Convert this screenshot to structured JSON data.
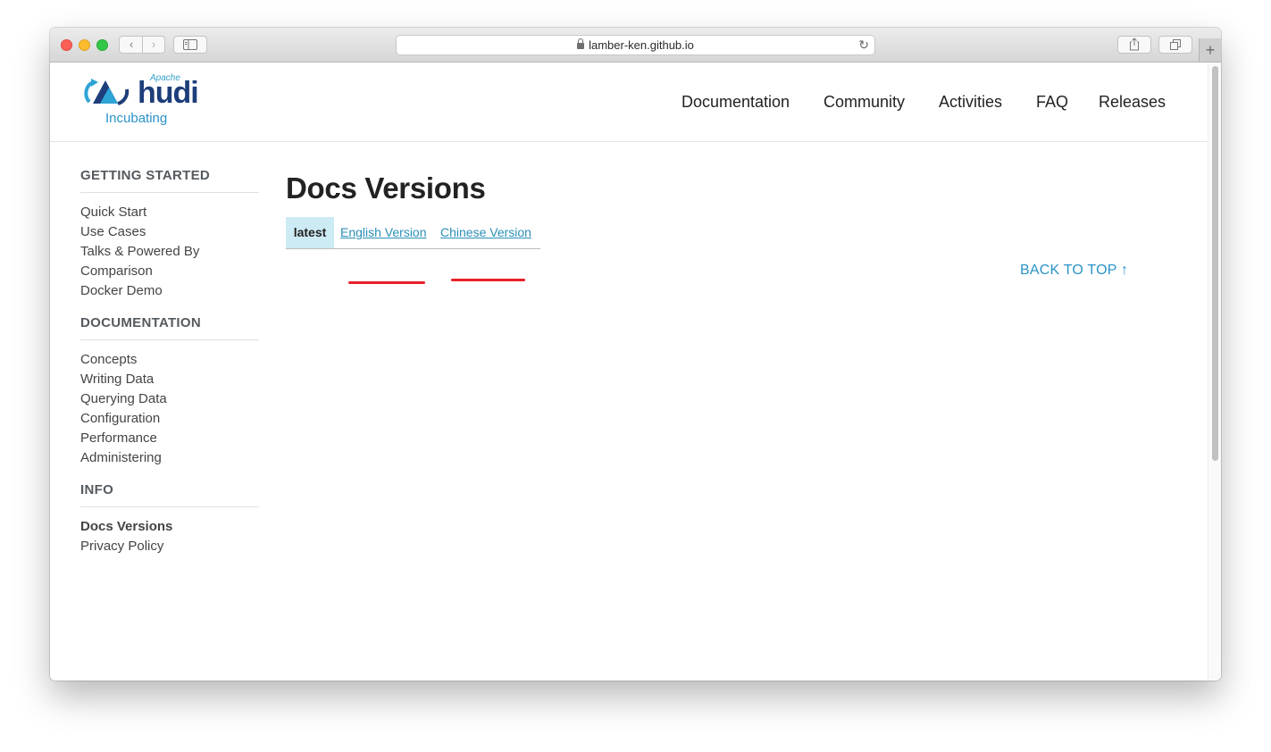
{
  "browser": {
    "url": "lamber-ken.github.io",
    "new_tab_label": "+"
  },
  "site": {
    "logo": {
      "apache": "Apache",
      "name": "hudi",
      "subtitle": "Incubating"
    },
    "nav": [
      "Documentation",
      "Community",
      "Activities",
      "FAQ",
      "Releases"
    ]
  },
  "sidebar": {
    "sections": [
      {
        "title": "GETTING STARTED",
        "items": [
          "Quick Start",
          "Use Cases",
          "Talks & Powered By",
          "Comparison",
          "Docker Demo"
        ]
      },
      {
        "title": "DOCUMENTATION",
        "items": [
          "Concepts",
          "Writing Data",
          "Querying Data",
          "Configuration",
          "Performance",
          "Administering"
        ]
      },
      {
        "title": "INFO",
        "items": [
          "Docs Versions",
          "Privacy Policy"
        ],
        "active": "Docs Versions"
      }
    ]
  },
  "main": {
    "title": "Docs Versions",
    "versions": {
      "label": "latest",
      "links": [
        "English Version",
        "Chinese Version"
      ]
    },
    "back_to_top": "BACK TO TOP ↑"
  },
  "colors": {
    "accent": "#2a93c9",
    "version_header_bg": "#cdebf4",
    "annotation_red": "#e8202a"
  }
}
